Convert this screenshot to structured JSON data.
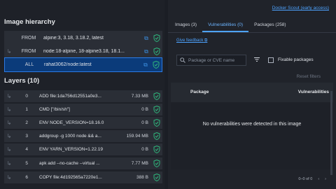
{
  "hierarchy": {
    "title": "Image hierarchy",
    "rows": [
      {
        "tag": "FROM",
        "name": "alpine:3, 3.18, 3.18.2, latest",
        "branch": ""
      },
      {
        "tag": "FROM",
        "name": "node:18-alpine, 18-alpine3.18, 18.1...",
        "branch": "↳"
      },
      {
        "tag": "ALL",
        "name": "rahat3062/node:latest",
        "branch": ""
      }
    ]
  },
  "layers": {
    "title": "Layers (10)",
    "rows": [
      {
        "idx": "0",
        "cmd": "ADD file:1da756d12551a0e3...",
        "size": "7.33 MB"
      },
      {
        "idx": "1",
        "cmd": "CMD [\"/bin/sh\"]",
        "size": "0 B"
      },
      {
        "idx": "2",
        "cmd": "ENV NODE_VERSION=18.16.0",
        "size": "0 B"
      },
      {
        "idx": "3",
        "cmd": "addgroup -g 1000 node && a...",
        "size": "159.94 MB"
      },
      {
        "idx": "4",
        "cmd": "ENV YARN_VERSION=1.22.19",
        "size": "0 B"
      },
      {
        "idx": "5",
        "cmd": "apk add --no-cache --virtual ...",
        "size": "7.77 MB"
      },
      {
        "idx": "6",
        "cmd": "COPY file:4d192565a7220e1...",
        "size": "388 B"
      }
    ]
  },
  "right": {
    "top_link": "Docker Scout (early access)",
    "tabs": [
      "Images (3)",
      "Vulnerabilities (0)",
      "Packages (258)"
    ],
    "feedback": "Give feedback",
    "search_placeholder": "Package or CVE name",
    "fixable_label": "Fixable packages",
    "reset_label": "Reset filters",
    "col_package": "Package",
    "col_vulns": "Vulnerabilities",
    "empty_message": "No vulnerabilities were detected in this image",
    "pager": "0–0 of 0"
  },
  "colors": {
    "accent": "#4da3ff",
    "shield": "#2fb67c",
    "selected": "#0b3b7a"
  }
}
